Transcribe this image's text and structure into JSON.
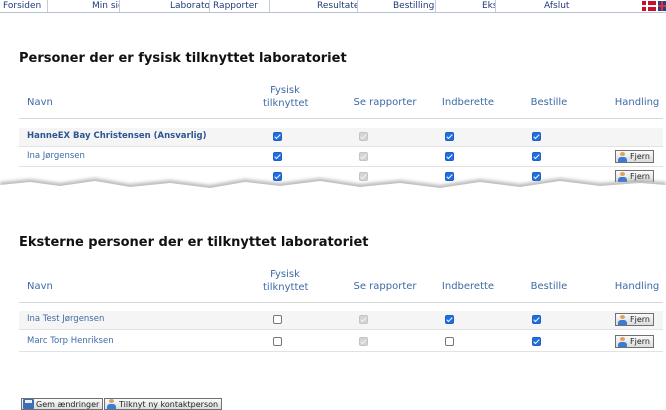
{
  "nav": {
    "items": [
      "Forsiden",
      "Min side",
      "Laboratorie info",
      "Rapporter",
      "Resultater",
      "Bestilling",
      "Ekspert",
      "Afslut"
    ]
  },
  "columns": {
    "navn": "Navn",
    "fysisk_line1": "Fysisk",
    "fysisk_line2": "tilknyttet",
    "se_rapporter": "Se rapporter",
    "indberette": "Indberette",
    "bestille": "Bestille",
    "handling": "Handling"
  },
  "section1": {
    "title": "Personer der er fysisk tilknyttet laboratoriet",
    "rows": [
      {
        "name": "HanneEX Bay Christensen (Ansvarlig)",
        "fysisk": true,
        "se_rapporter": true,
        "indberette": true,
        "bestille": true,
        "action": ""
      },
      {
        "name": "Ina Jørgensen",
        "fysisk": true,
        "se_rapporter": true,
        "indberette": true,
        "bestille": true,
        "action": "Fjern"
      },
      {
        "name": "",
        "fysisk": true,
        "se_rapporter": true,
        "indberette": true,
        "bestille": true,
        "action": "Fjern"
      }
    ]
  },
  "section2": {
    "title": "Eksterne personer der er tilknyttet laboratoriet",
    "rows": [
      {
        "name": "Ina Test Jørgensen",
        "fysisk": false,
        "se_rapporter": true,
        "indberette": true,
        "bestille": true,
        "action": "Fjern"
      },
      {
        "name": "Marc Torp Henriksen",
        "fysisk": false,
        "se_rapporter": true,
        "indberette": false,
        "bestille": true,
        "action": "Fjern"
      }
    ]
  },
  "footer": {
    "save_label": "Gem ændringer",
    "add_contact_label": "Tilknyt ny kontaktperson"
  },
  "colors": {
    "accent_blue": "#1f6fe0",
    "header_text": "#3d6aa6"
  }
}
